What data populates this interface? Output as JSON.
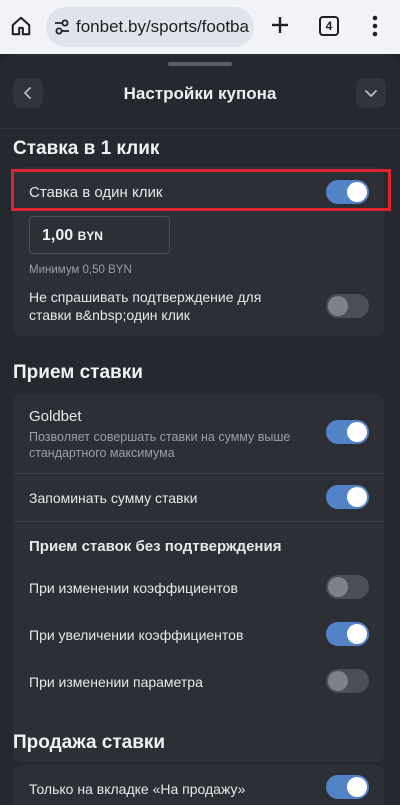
{
  "browser": {
    "url": "fonbet.by/sports/footba",
    "tab_count": "4",
    "icons": [
      "home-icon",
      "site-settings-icon",
      "new-tab-icon",
      "tab-switcher-icon",
      "more-menu-icon"
    ]
  },
  "sheet": {
    "title": "Настройки купона"
  },
  "one_click": {
    "section_title": "Ставка в 1 клик",
    "toggle_label": "Ставка в один клик",
    "toggle_on": true,
    "amount_value": "1,00",
    "amount_currency": "BYN",
    "minimum_label": "Минимум 0,50 BYN",
    "no_confirm_line1": "Не спрашивать подтверждение для",
    "no_confirm_line2": "ставки в&nbsp;один клик",
    "no_confirm_on": false
  },
  "acceptance": {
    "section_title": "Прием ставки",
    "goldbet_label": "Goldbet",
    "goldbet_desc_line1": "Позволяет совершать ставки на сумму выше",
    "goldbet_desc_line2": "стандартного максимума",
    "goldbet_on": true,
    "remember_label": "Запоминать сумму ставки",
    "remember_on": true,
    "subheading": "Прием ставок без подтверждения",
    "odds_change_label": "При изменении коэффициентов",
    "odds_change_on": false,
    "odds_increase_label": "При увеличении коэффициентов",
    "odds_increase_on": true,
    "param_change_label": "При изменении параметра",
    "param_change_on": false
  },
  "sale": {
    "section_title": "Продажа ставки",
    "sale_tab_label": "Только на вкладке «На продажу»",
    "sale_tab_on": true
  },
  "colors": {
    "accent": "#5383c6",
    "highlight": "#e0232c",
    "background": "#25282e",
    "card": "#2c3036"
  }
}
